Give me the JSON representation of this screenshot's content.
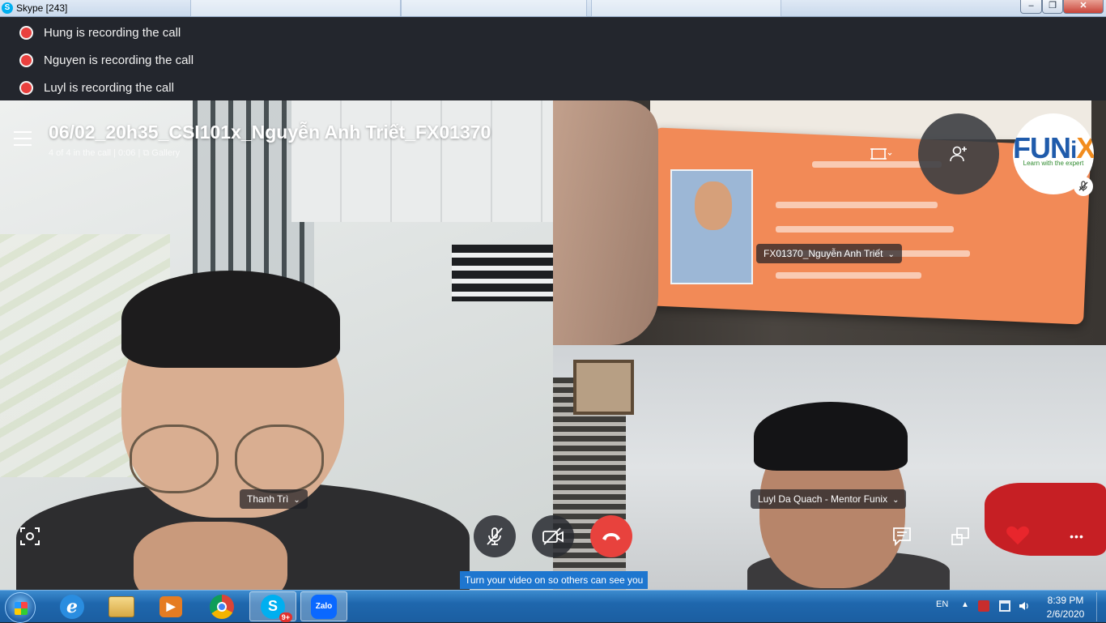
{
  "window": {
    "title": "Skype [243]",
    "app_icon_glyph": "S",
    "minimize_glyph": "–",
    "maximize_glyph": "❐",
    "close_glyph": "✕"
  },
  "recording_notices": [
    {
      "text": "Hung is recording the call"
    },
    {
      "text": "Nguyen is recording the call"
    },
    {
      "text": "Luyl is recording the call"
    }
  ],
  "call": {
    "title": "06/02_20h35_CSI101x_Nguyễn Anh Triết_FX01370",
    "info": "4 of 4 in the call | 0:06 | ⧉ Gallery"
  },
  "participants": [
    {
      "name": "Thanh  Trì"
    },
    {
      "name": "FX01370_Nguyễn Anh Triết"
    },
    {
      "name": "Luyl Da Quach - Mentor Funix"
    }
  ],
  "avatar": {
    "brand_main": "FUN",
    "brand_x": "X",
    "brand_i": "i",
    "tagline": "Learn with the expert"
  },
  "controls": {
    "tooltip": "Turn your video on so others can see you",
    "more_glyph": "•••"
  },
  "taskbar": {
    "apps": [
      {
        "name": "internet-explorer",
        "glyph": "e"
      },
      {
        "name": "file-explorer",
        "glyph": ""
      },
      {
        "name": "media-player",
        "glyph": "▶"
      },
      {
        "name": "chrome",
        "glyph": ""
      },
      {
        "name": "skype",
        "glyph": "S",
        "badge": "9+"
      },
      {
        "name": "zalo",
        "glyph": "Zalo"
      }
    ],
    "language": "EN",
    "tray_arrow": "▲",
    "time": "8:39 PM",
    "date": "2/6/2020"
  },
  "colors": {
    "recording_red": "#e9403e",
    "end_call_red": "#e8423d",
    "tooltip_blue": "#1e76cf",
    "heart_red": "#e8262c"
  }
}
